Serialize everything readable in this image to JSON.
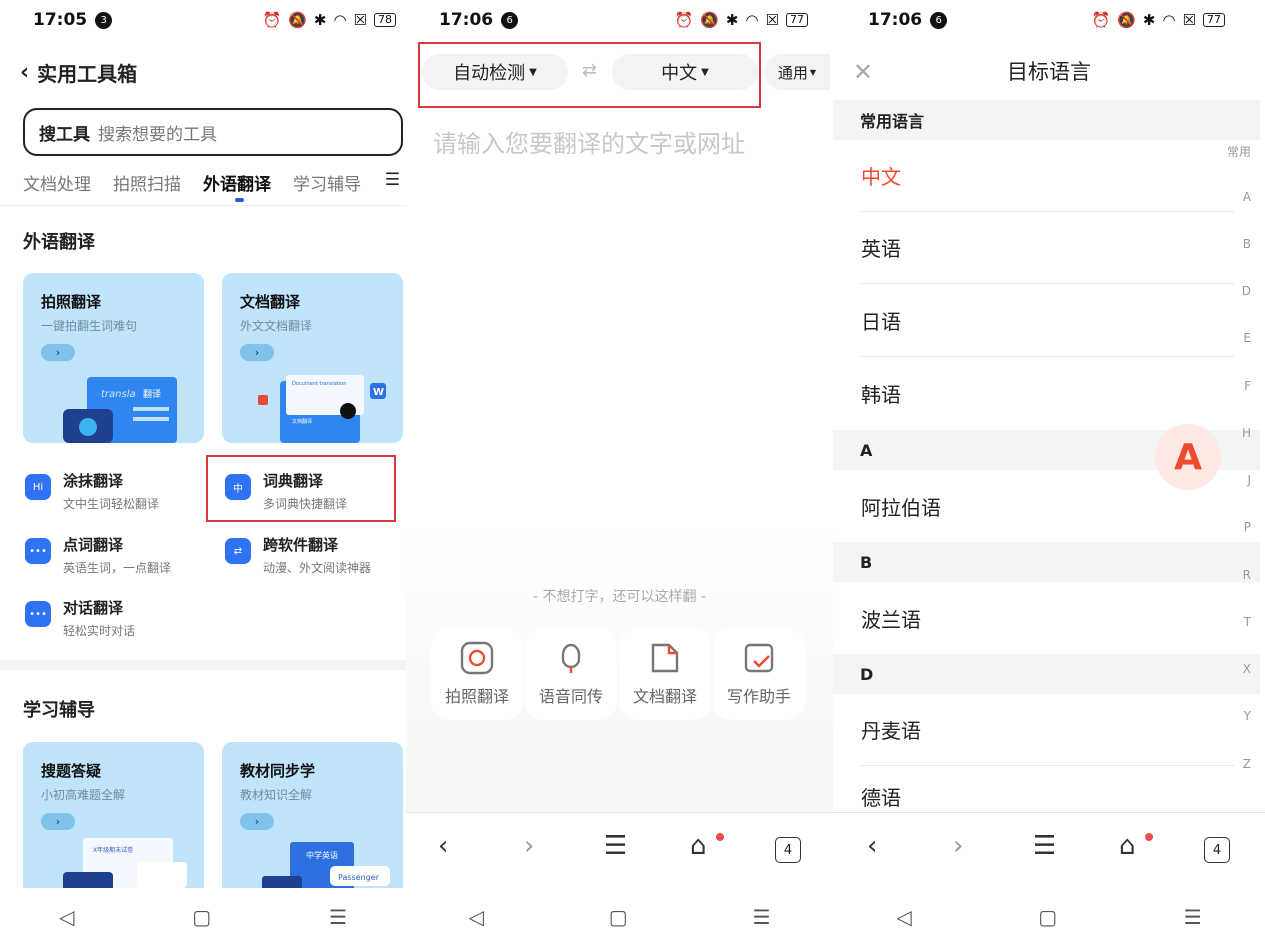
{
  "panel1": {
    "status": {
      "time": "17:05",
      "notif": "3",
      "battery": "78"
    },
    "back_title": "实用工具箱",
    "search": {
      "label": "搜工具",
      "placeholder": "搜索想要的工具"
    },
    "tabs": [
      "文档处理",
      "拍照扫描",
      "外语翻译",
      "学习辅导"
    ],
    "active_tab_index": 2,
    "section1": "外语翻译",
    "cards": [
      {
        "title": "拍照翻译",
        "subtitle": "一键拍翻生词难句",
        "art_text": "transla",
        "art_label": "翻译"
      },
      {
        "title": "文档翻译",
        "subtitle": "外文文档翻译",
        "art_text": "Document translation",
        "art_label": "文档翻译",
        "badge": "W"
      }
    ],
    "tools": [
      {
        "name": "涂抹翻译",
        "desc": "文中生词轻松翻译",
        "icon": "Hi"
      },
      {
        "name": "词典翻译",
        "desc": "多词典快捷翻译",
        "icon": "中"
      },
      {
        "name": "点词翻译",
        "desc": "英语生词，一点翻译",
        "icon": "•••"
      },
      {
        "name": "跨软件翻译",
        "desc": "动漫、外文阅读神器",
        "icon": "⇄"
      },
      {
        "name": "对话翻译",
        "desc": "轻松实时对话",
        "icon": "•••"
      }
    ],
    "section2": "学习辅导",
    "cards2": [
      {
        "title": "搜题答疑",
        "subtitle": "小初高难题全解",
        "art_text": "X年级期末试卷"
      },
      {
        "title": "教材同步学",
        "subtitle": "教材知识全解",
        "art_text": "中学英语",
        "badge": "Passenger"
      }
    ]
  },
  "panel2": {
    "status": {
      "time": "17:06",
      "notif": "6",
      "battery": "77"
    },
    "source_lang": "自动检测",
    "target_lang": "中文",
    "mode": "通用",
    "placeholder": "请输入您要翻译的文字或网址",
    "hint": "- 不想打字，还可以这样翻 -",
    "quick_actions": [
      "拍照翻译",
      "语音同传",
      "文档翻译",
      "写作助手"
    ],
    "tab_count": "4"
  },
  "panel3": {
    "status": {
      "time": "17:06",
      "notif": "6",
      "battery": "77"
    },
    "title": "目标语言",
    "common_header": "常用语言",
    "common": [
      "中文",
      "英语",
      "日语",
      "韩语"
    ],
    "groups": [
      {
        "letter": "A",
        "items": [
          "阿拉伯语"
        ]
      },
      {
        "letter": "B",
        "items": [
          "波兰语"
        ]
      },
      {
        "letter": "D",
        "items": [
          "丹麦语",
          "德语"
        ]
      }
    ],
    "index": [
      "常用",
      "A",
      "B",
      "D",
      "E",
      "F",
      "H",
      "J",
      "P",
      "R",
      "T",
      "X",
      "Y",
      "Z"
    ],
    "bubble_letter": "A",
    "tab_count": "4"
  },
  "colors": {
    "accent_red": "#ef4a2f",
    "card_blue": "#bfe4fb",
    "tab_blue": "#2a5ad8",
    "highlight": "#d9363e"
  }
}
